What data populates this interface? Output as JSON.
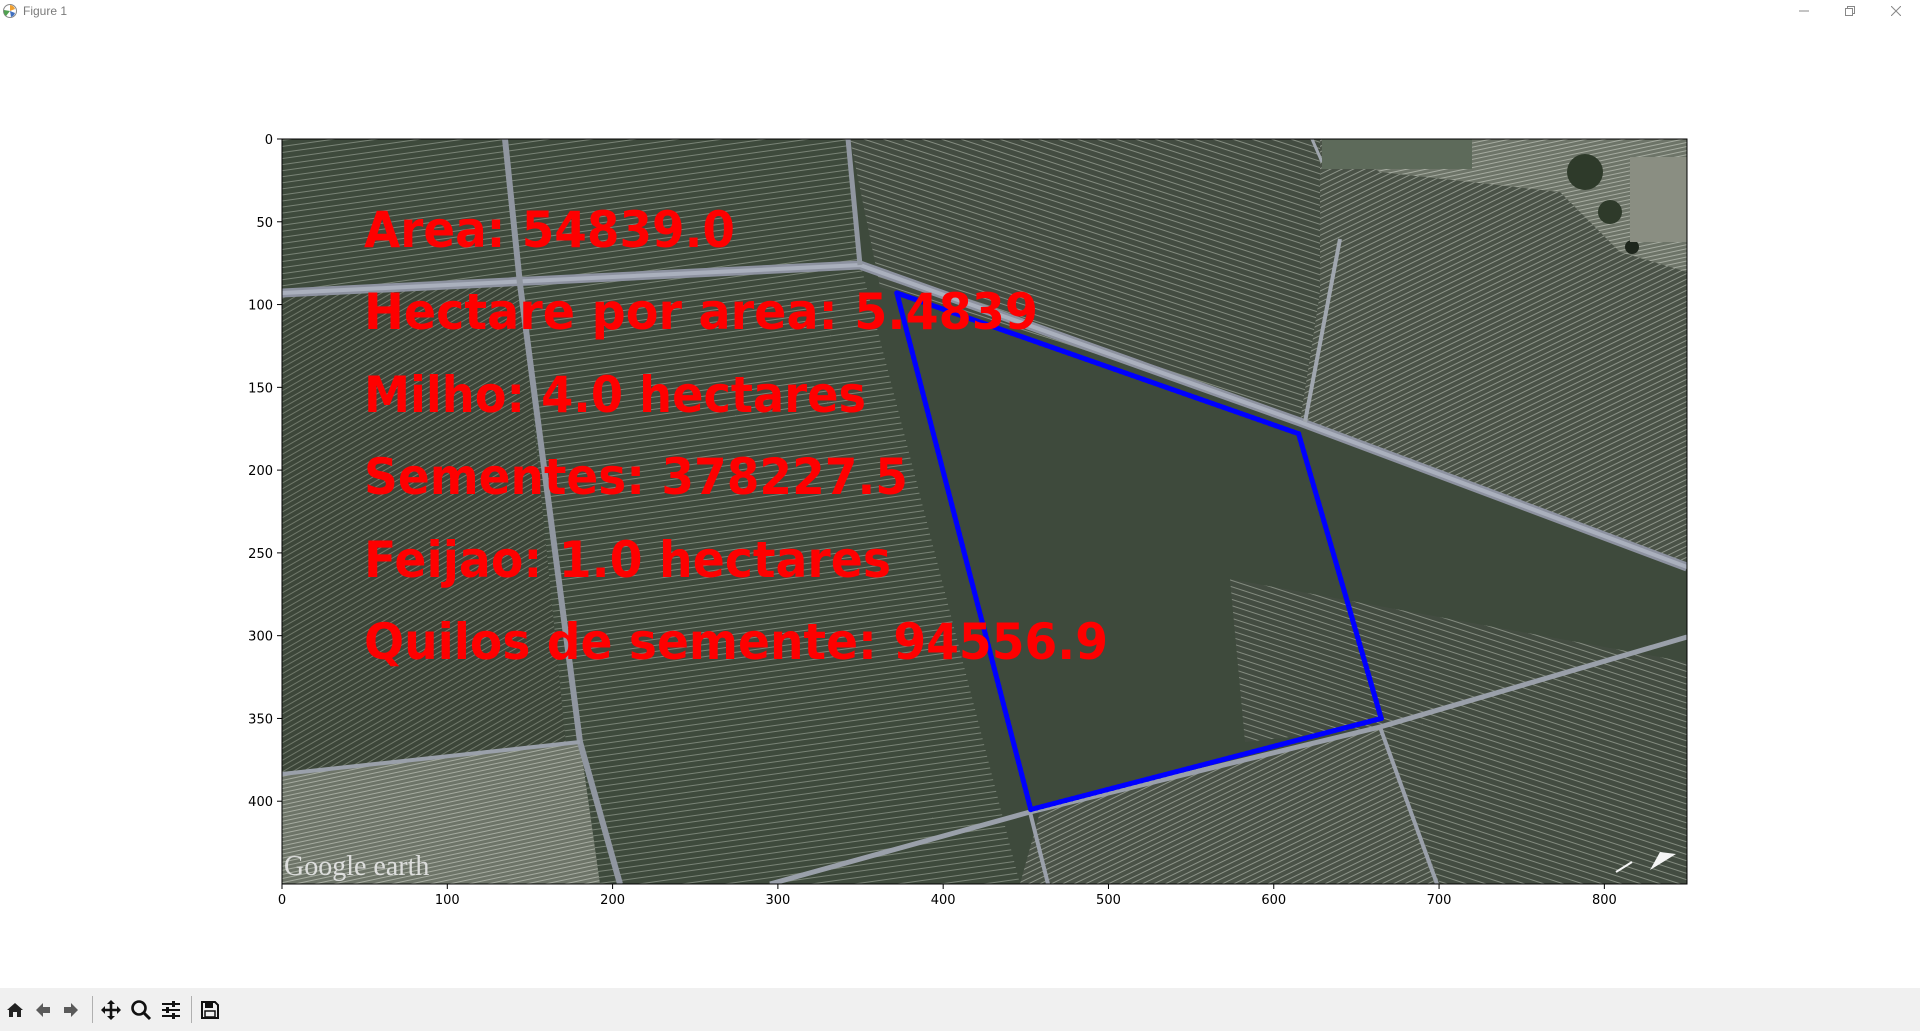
{
  "window": {
    "title": "Figure 1"
  },
  "chart_data": {
    "type": "image",
    "xticks": [
      "0",
      "100",
      "200",
      "300",
      "400",
      "500",
      "600",
      "700",
      "800"
    ],
    "yticks": [
      "0",
      "50",
      "100",
      "150",
      "200",
      "250",
      "300",
      "350",
      "400"
    ],
    "xlim": [
      0,
      850
    ],
    "ylim": [
      450,
      0
    ],
    "image_watermark": "Google earth",
    "overlay_text": [
      "Area: 54839.0",
      "Hectare por area: 5.4839",
      "Milho: 4.0 hectares",
      "Sementes: 378227.5",
      "Feijao: 1.0 hectares",
      "Quilos de semente: 94556.9"
    ],
    "overlay_color": "#ff0000",
    "polygon_color": "#0000ff",
    "polygon": [
      [
        372,
        93
      ],
      [
        615,
        178
      ],
      [
        665,
        350
      ],
      [
        453,
        405
      ],
      [
        372,
        93
      ]
    ]
  },
  "toolbar": {
    "buttons": [
      "home-icon",
      "back-icon",
      "forward-icon",
      "pan-icon",
      "zoom-icon",
      "configure-subplots-icon",
      "save-icon"
    ]
  }
}
